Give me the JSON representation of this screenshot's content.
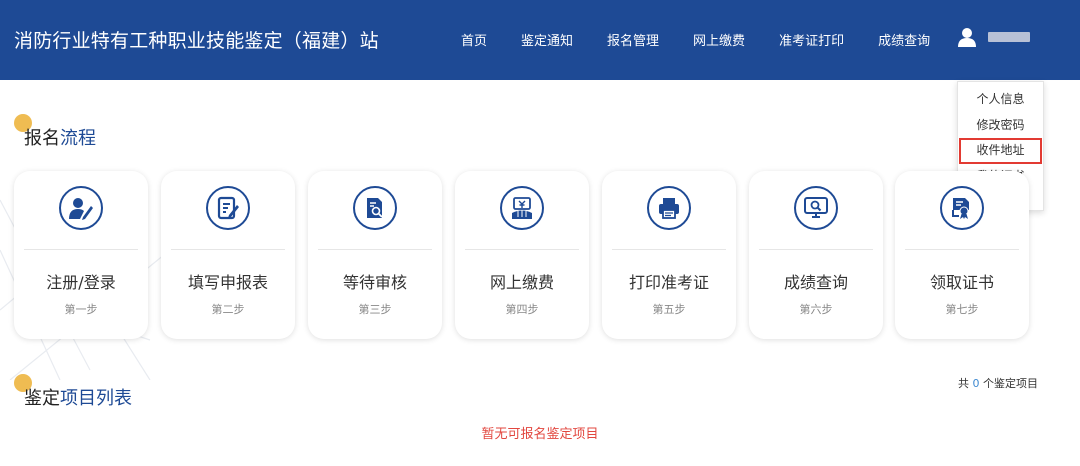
{
  "header": {
    "title": "消防行业特有工种职业技能鉴定（福建）站",
    "nav": [
      "首页",
      "鉴定通知",
      "报名管理",
      "网上缴费",
      "准考证打印",
      "成绩查询"
    ],
    "user_icon": "user-icon"
  },
  "dropdown": {
    "items": [
      "个人信息",
      "修改密码",
      "收件地址",
      "我的证书",
      "退　 出"
    ],
    "highlighted": "收件地址",
    "highlight_color": "#e23a32"
  },
  "process": {
    "title_plain": "报名",
    "title_accent": "流程",
    "steps": [
      {
        "icon": "user-edit-icon",
        "title": "注册/登录",
        "step": "第一步"
      },
      {
        "icon": "form-edit-icon",
        "title": "填写申报表",
        "step": "第二步"
      },
      {
        "icon": "document-search-icon",
        "title": "等待审核",
        "step": "第三步"
      },
      {
        "icon": "payment-icon",
        "title": "网上缴费",
        "step": "第四步"
      },
      {
        "icon": "printer-icon",
        "title": "打印准考证",
        "step": "第五步"
      },
      {
        "icon": "monitor-search-icon",
        "title": "成绩查询",
        "step": "第六步"
      },
      {
        "icon": "certificate-icon",
        "title": "领取证书",
        "step": "第七步"
      }
    ]
  },
  "projects": {
    "title_plain": "鉴定",
    "title_accent": "项目列表",
    "count_prefix": "共",
    "count": "0",
    "count_suffix": "个鉴定项目",
    "empty_text": "暂无可报名鉴定项目"
  },
  "colors": {
    "header_bg": "#1e4a95",
    "accent": "#1e4a95",
    "dot": "#efbc52",
    "empty_text": "#e2473f",
    "count_number": "#3f8ad1"
  }
}
